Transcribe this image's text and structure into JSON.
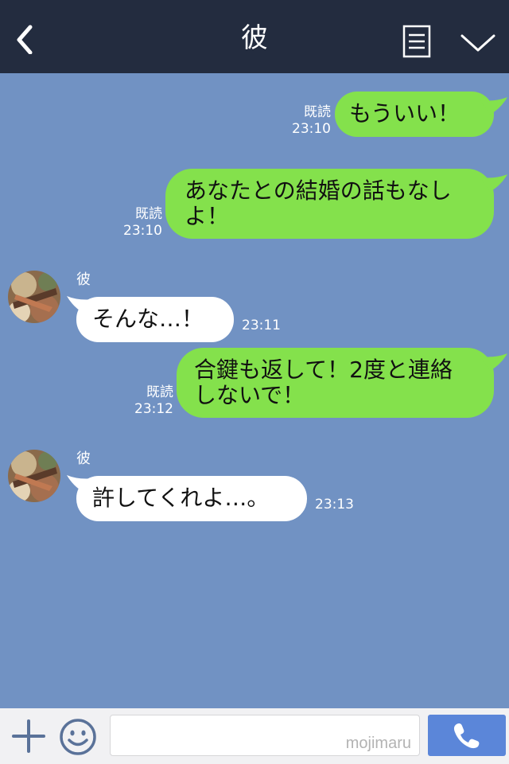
{
  "header": {
    "title": "彼"
  },
  "messages": [
    {
      "direction": "out",
      "lines": [
        "もういい！"
      ],
      "read": "既読",
      "time": "23:10"
    },
    {
      "direction": "out",
      "lines": [
        "あなたとの結婚の話もなし",
        "よ！"
      ],
      "read": "既読",
      "time": "23:10"
    },
    {
      "direction": "in",
      "sender": "彼",
      "lines": [
        "そんな…！"
      ],
      "time": "23:11"
    },
    {
      "direction": "out",
      "lines": [
        "合鍵も返して！2度と連絡",
        "しないで！"
      ],
      "read": "既読",
      "time": "23:12"
    },
    {
      "direction": "in",
      "sender": "彼",
      "lines": [
        "許してくれよ…。"
      ],
      "time": "23:13"
    }
  ],
  "input": {
    "watermark": "mojimaru"
  },
  "colors": {
    "header_bg": "#232c3f",
    "chat_bg": "#7192c3",
    "outgoing_bubble": "#84e14c",
    "incoming_bubble": "#ffffff",
    "call_button": "#5b86d9"
  },
  "icons": {
    "back": "chevron-left-icon",
    "menu": "list-icon",
    "collapse": "chevron-down-icon",
    "add": "plus-icon",
    "emoji": "smiley-icon",
    "call": "phone-icon"
  }
}
